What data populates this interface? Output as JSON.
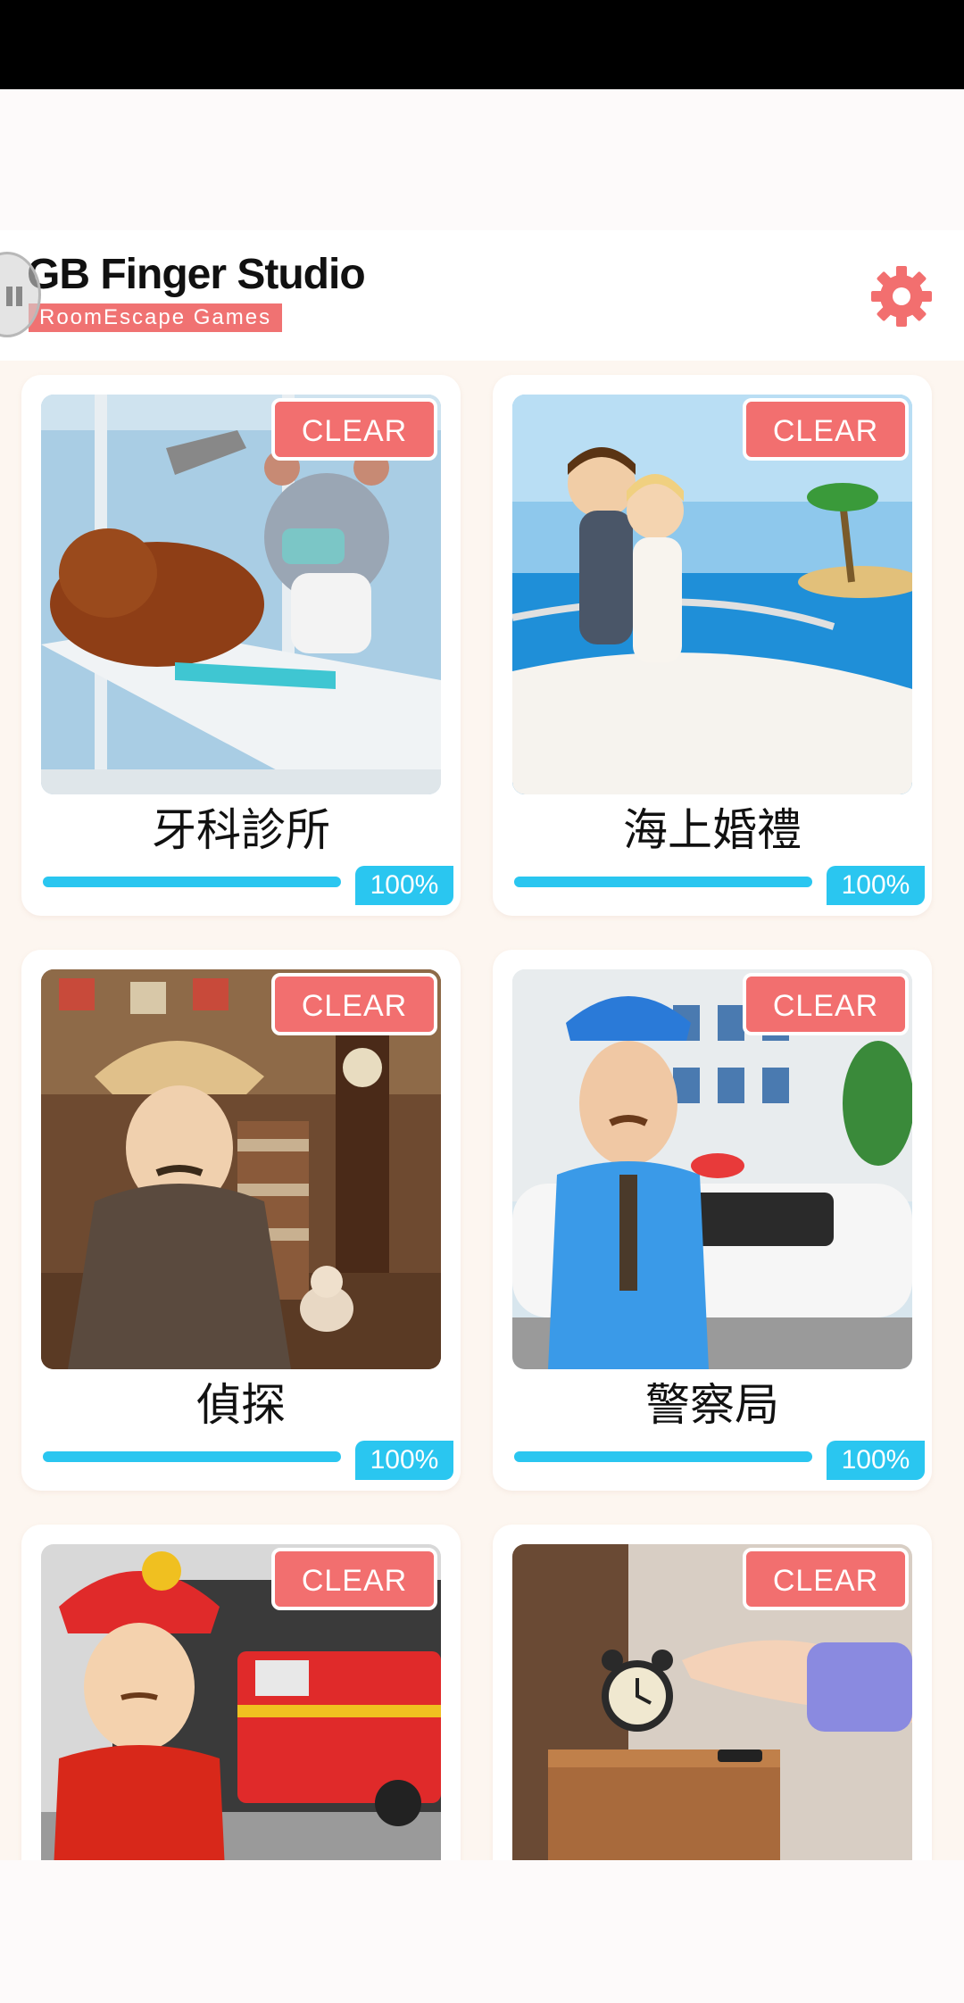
{
  "header": {
    "title": "GB Finger Studio",
    "subtitle": "RoomEscape Games",
    "settings_icon": "gear-icon"
  },
  "colors": {
    "accent": "#f26f6f",
    "progress": "#2ac6f0"
  },
  "games": [
    {
      "title": "牙科診所",
      "badge": "CLEAR",
      "progress": 1.0,
      "percent_label": "100%"
    },
    {
      "title": "海上婚禮",
      "badge": "CLEAR",
      "progress": 1.0,
      "percent_label": "100%"
    },
    {
      "title": "偵探",
      "badge": "CLEAR",
      "progress": 1.0,
      "percent_label": "100%"
    },
    {
      "title": "警察局",
      "badge": "CLEAR",
      "progress": 1.0,
      "percent_label": "100%"
    },
    {
      "title": "",
      "badge": "CLEAR"
    },
    {
      "title": "",
      "badge": "CLEAR"
    }
  ]
}
